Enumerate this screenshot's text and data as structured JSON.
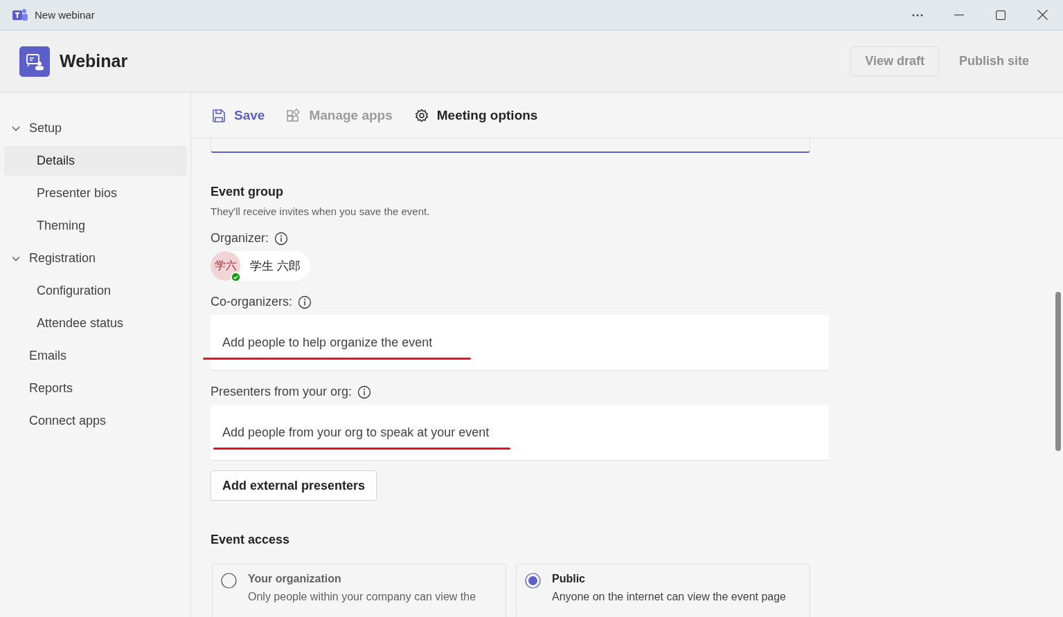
{
  "window": {
    "title": "New webinar"
  },
  "header": {
    "title": "Webinar",
    "buttons": [
      {
        "label": "View draft",
        "disabled": true,
        "kind": "outline"
      },
      {
        "label": "Publish site",
        "disabled": true,
        "kind": "plain"
      }
    ]
  },
  "sidebar": {
    "items": [
      {
        "label": "Setup",
        "expanded": true,
        "selected": false,
        "children": [
          {
            "label": "Details",
            "selected": true
          },
          {
            "label": "Presenter bios",
            "selected": false
          },
          {
            "label": "Theming",
            "selected": false
          }
        ]
      },
      {
        "label": "Registration",
        "expanded": true,
        "selected": false,
        "children": [
          {
            "label": "Configuration",
            "selected": false
          },
          {
            "label": "Attendee status",
            "selected": false
          }
        ]
      },
      {
        "label": "Emails",
        "selected": false
      },
      {
        "label": "Reports",
        "selected": false
      },
      {
        "label": "Connect apps",
        "selected": false
      }
    ]
  },
  "toolbar": [
    {
      "kind": "save",
      "label": "Save",
      "disabled": false
    },
    {
      "kind": "apps",
      "label": "Manage apps",
      "disabled": true
    },
    {
      "kind": "options",
      "label": "Meeting options",
      "disabled": false
    }
  ],
  "event_group": {
    "title": "Event group",
    "description": "They'll receive invites when you save the event.",
    "organizer_label": "Organizer:",
    "organizer": {
      "initials": "学六",
      "name": "学生 六郎",
      "available": true
    },
    "co_organizers_label": "Co-organizers:",
    "co_organizers_placeholder": "Add people to help organize the event",
    "presenters_label": "Presenters from your org:",
    "presenters_placeholder": "Add people from your org to speak at your event",
    "external_button": "Add external presenters"
  },
  "event_access": {
    "title": "Event access",
    "options": [
      {
        "label": "Your organization",
        "description": "Only people within your company can view the",
        "selected": false
      },
      {
        "label": "Public",
        "description": "Anyone on the internet can view the event page",
        "selected": true
      }
    ]
  }
}
